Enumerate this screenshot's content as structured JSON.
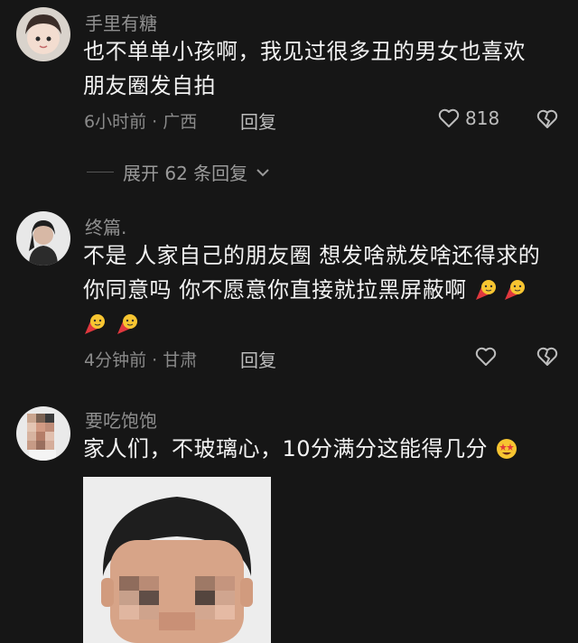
{
  "comments": [
    {
      "username": "手里有糖",
      "text_lines": [
        "也不单单小孩啊，我见过很多丑的男女也喜欢",
        "朋友圈发自拍"
      ],
      "time": "6小时前",
      "location": "广西",
      "reply_label": "回复",
      "likes": "818"
    },
    {
      "username": "终篇.",
      "text_lines": [
        "不是 人家自己的朋友圈 想发啥就发啥还得求的",
        "你同意吗 你不愿意你直接就拉黑屏蔽啊"
      ],
      "time": "4分钟前",
      "location": "甘肃",
      "reply_label": "回复"
    },
    {
      "username": "要吃饱饱",
      "text_lines": [
        "家人们，不玻璃心，10分满分这能得几分"
      ]
    }
  ],
  "expand_replies": "展开 62 条回复",
  "meta_separator": " · "
}
